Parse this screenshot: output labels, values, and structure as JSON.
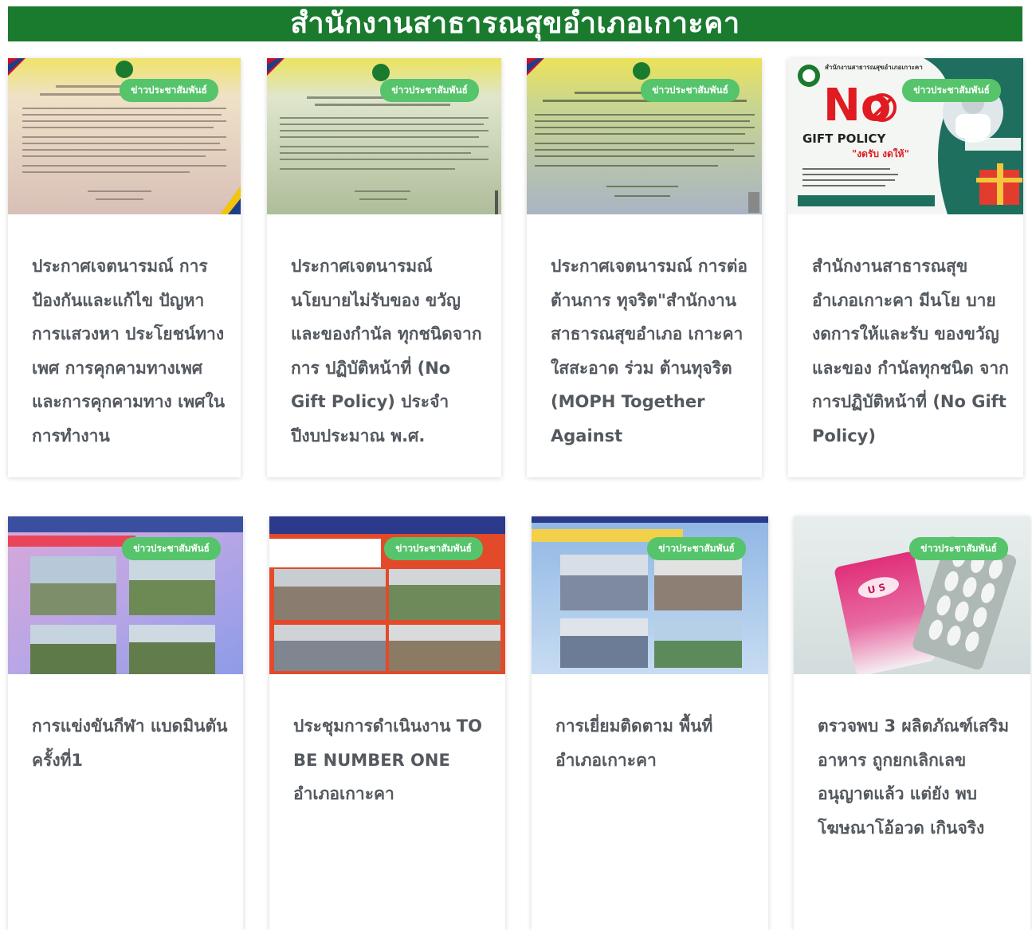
{
  "header": {
    "title": "สำนักงานสาธารณสุขอำเภอเกาะคา"
  },
  "colors": {
    "header_bg": "#1a7a2e",
    "badge_bg": "#55c46a",
    "title_text": "#54595f"
  },
  "posts": [
    {
      "badge": "ข่าวประชาสัมพันธ์",
      "title": "ประกาศเจตนารมณ์ การป้องกันและแก้ไข ปัญหาการแสวงหา ประโยชน์ทางเพศ การคุกคามทางเพศ และการคุกคามทาง เพศในการทำงาน",
      "image_icon": "announcement-document-image"
    },
    {
      "badge": "ข่าวประชาสัมพันธ์",
      "title": "ประกาศเจตนารมณ์ นโยบายไม่รับของ ขวัญและของกำนัล ทุกชนิดจากการ ปฏิบัติหน้าที่ (No Gift Policy) ประจำ ปีงบประมาณ พ.ศ.",
      "image_icon": "announcement-document-image"
    },
    {
      "badge": "ข่าวประชาสัมพันธ์",
      "title": "ประกาศเจตนารมณ์ การต่อต้านการ ทุจริต\"สำนักงาน สาธารณสุขอำเภอ เกาะคาใสสะอาด ร่วม ต้านทุจริต (MOPH Together Against",
      "image_icon": "announcement-document-image"
    },
    {
      "badge": "ข่าวประชาสัมพันธ์",
      "title": "สำนักงานสาธารณสุข อำเภอเกาะคา มีนโย บาย งดการให้และรับ ของขวัญและของ กำนัลทุกชนิด จาก การปฏิบัติหน้าที่ (No Gift Policy)",
      "image_icon": "no-gift-policy-poster-image",
      "image_text": {
        "org": "สำนักงานสาธารณสุขอำเภอเกาะคา",
        "big": "No",
        "policy": "GIFT POLICY",
        "slogan": "\"งดรับ งดให้\""
      }
    },
    {
      "badge": "ข่าวประชาสัมพันธ์",
      "title": "การแข่งขันกีฬา แบดมินตัน ครั้งที่1",
      "image_icon": "photo-collage-image"
    },
    {
      "badge": "ข่าวประชาสัมพันธ์",
      "title": "ประชุมการดำเนินงาน TO BE NUMBER ONE อำเภอเกาะคา",
      "image_icon": "photo-collage-image"
    },
    {
      "badge": "ข่าวประชาสัมพันธ์",
      "title": "การเยี่ยมติดตาม พื้นที่ อำเภอเกาะคา",
      "image_icon": "photo-collage-image"
    },
    {
      "badge": "ข่าวประชาสัมพันธ์",
      "title": "ตรวจพบ 3 ผลิตภัณฑ์เสริม อาหาร ถูกยกเลิกเลข อนุญาตแล้ว แต่ยัง พบโฆษณาโอ้อวด เกินจริง",
      "image_icon": "supplement-pills-image",
      "image_text": {
        "pack_label": "U S"
      }
    }
  ]
}
